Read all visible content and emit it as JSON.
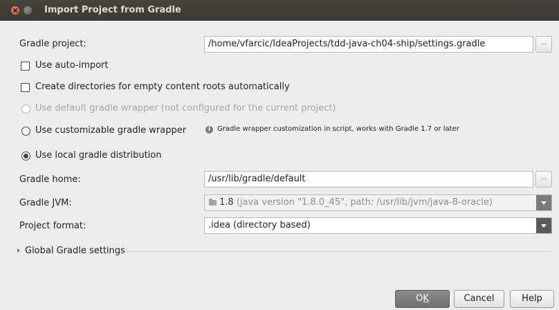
{
  "window": {
    "title": "Import Project from Gradle"
  },
  "form": {
    "gradle_project": {
      "label": "Gradle project:",
      "value": "/home/vfarcic/IdeaProjects/tdd-java-ch04-ship/settings.gradle",
      "browse_label": "..."
    },
    "use_auto_import": {
      "label": "Use auto-import",
      "checked": false
    },
    "create_dirs": {
      "label": "Create directories for empty content roots automatically",
      "checked": false
    },
    "wrapper_options": {
      "default_wrapper": {
        "label": "Use default gradle wrapper (not configured for the current project)",
        "enabled": false
      },
      "custom_wrapper": {
        "label": "Use customizable gradle wrapper",
        "selected": false
      },
      "info": "Gradle wrapper customization in script, works with Gradle 1.7 or later",
      "local_distribution": {
        "label": "Use local gradle distribution",
        "selected": true
      }
    },
    "gradle_home": {
      "label": "Gradle home:",
      "value": "/usr/lib/gradle/default",
      "browse_label": "..."
    },
    "gradle_jvm": {
      "label": "Gradle JVM:",
      "version": "1.8",
      "details": "(java version \"1.8.0_45\", path: /usr/lib/jvm/java-8-oracle)"
    },
    "project_format": {
      "label": "Project format:",
      "value": ".idea (directory based)"
    },
    "global_settings": {
      "label": "Global Gradle settings"
    }
  },
  "buttons": {
    "ok_prefix": "O",
    "ok_underlined": "K",
    "cancel": "Cancel",
    "help": "Help"
  },
  "icons": [
    "close-icon",
    "minimize-icon",
    "info-icon",
    "folder-icon",
    "chevron-down-icon",
    "expand-arrow-icon"
  ],
  "colors": {
    "titlebar": "#3d3c38",
    "background": "#ededed",
    "primary_button": "#7d7d7d"
  }
}
